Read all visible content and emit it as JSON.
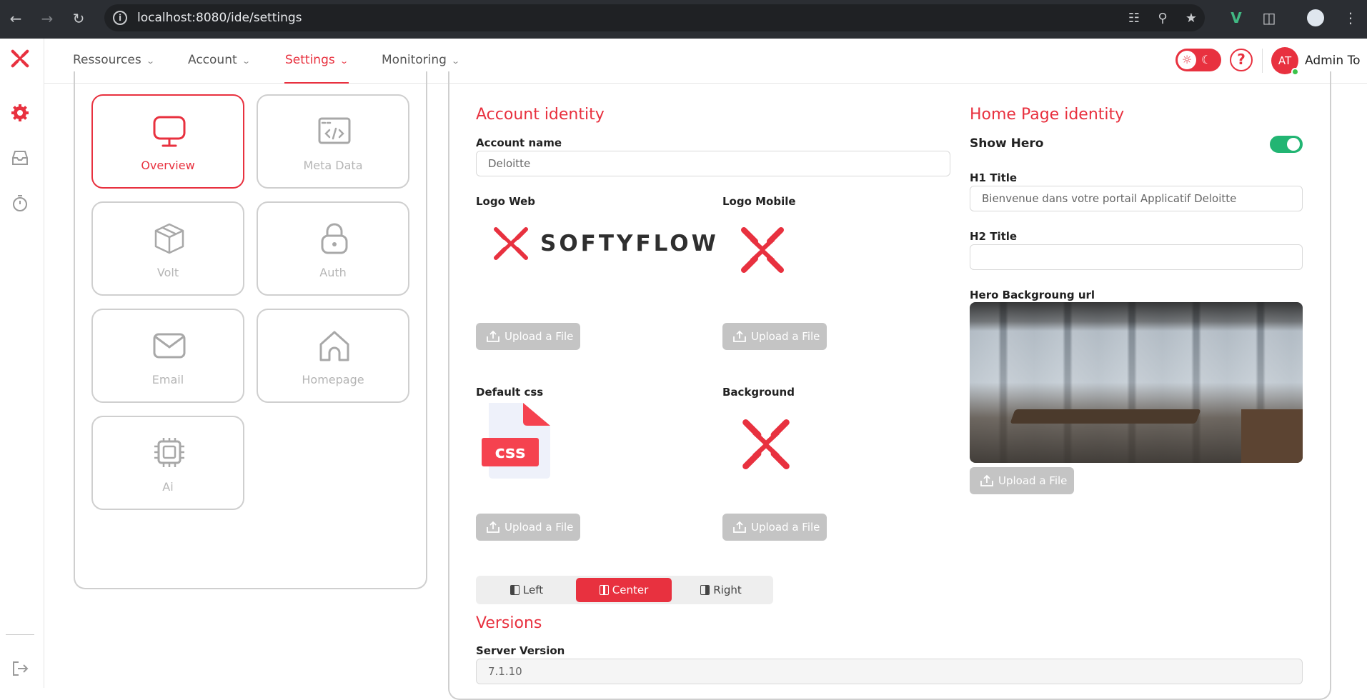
{
  "browser": {
    "url": "localhost:8080/ide/settings"
  },
  "header": {
    "menus": [
      {
        "label": "Ressources"
      },
      {
        "label": "Account"
      },
      {
        "label": "Settings"
      },
      {
        "label": "Monitoring"
      }
    ],
    "help": "?",
    "avatar_initials": "AT",
    "user_name": "Admin To"
  },
  "tiles": [
    {
      "label": "Overview",
      "icon": "monitor-icon"
    },
    {
      "label": "Meta Data",
      "icon": "code-icon"
    },
    {
      "label": "Volt",
      "icon": "box-icon"
    },
    {
      "label": "Auth",
      "icon": "lock-icon"
    },
    {
      "label": "Email",
      "icon": "mail-icon"
    },
    {
      "label": "Homepage",
      "icon": "home-icon"
    },
    {
      "label": "Ai",
      "icon": "chip-icon"
    }
  ],
  "account": {
    "title": "Account identity",
    "name_label": "Account name",
    "name_value": "Deloitte",
    "logo_web_label": "Logo Web",
    "logo_web_text": "SOFTYFLOW",
    "logo_mobile_label": "Logo Mobile",
    "default_css_label": "Default css",
    "css_badge": "css",
    "background_label": "Background",
    "upload_label": "Upload a File"
  },
  "alignment": {
    "left": "Left",
    "center": "Center",
    "right": "Right",
    "selected": "Center"
  },
  "versions": {
    "title": "Versions",
    "server_label": "Server Version",
    "server_value": "7.1.10"
  },
  "home": {
    "title": "Home Page identity",
    "show_hero_label": "Show Hero",
    "show_hero": true,
    "h1_label": "H1 Title",
    "h1_value": "Bienvenue dans votre portail Applicatif Deloitte",
    "h2_label": "H2 Title",
    "h2_value": "",
    "hero_bg_label": "Hero Backgroung url",
    "upload_label": "Upload a File"
  },
  "colors": {
    "accent": "#e8313f",
    "toggle_on": "#22b573",
    "upload_disabled": "#c4c4c4"
  }
}
